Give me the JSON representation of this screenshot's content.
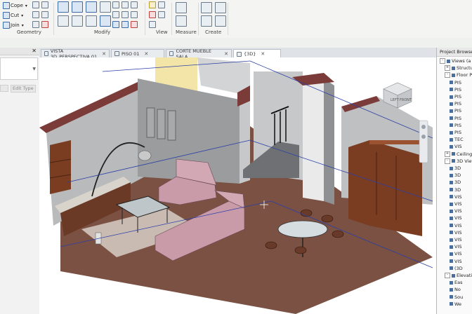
{
  "ribbon": {
    "cope_label": "Cope",
    "cut_label": "Cut",
    "join_label": "Join",
    "groups": {
      "geometry": "Geometry",
      "modify": "Modify",
      "view": "View",
      "measure": "Measure",
      "create": "Create"
    }
  },
  "properties": {
    "edit_type_label": "Edit Type"
  },
  "tabs": [
    {
      "label": "VISTA 3D_PERSPECTIVA 01",
      "active": false
    },
    {
      "label": "PISO 01",
      "active": false
    },
    {
      "label": "CORTE MUEBLE SALA",
      "active": false
    },
    {
      "label": "{3D}",
      "active": true
    }
  ],
  "viewcube": {
    "left": "LEFT",
    "front": "FRONT"
  },
  "project_browser": {
    "title": "Project Browser",
    "items": [
      {
        "label": "Views (a",
        "level": 0,
        "toggle": "-"
      },
      {
        "label": "Structu",
        "level": 1,
        "toggle": "+"
      },
      {
        "label": "Floor P",
        "level": 1,
        "toggle": "-"
      },
      {
        "label": "PIS",
        "level": 2
      },
      {
        "label": "PIS",
        "level": 2
      },
      {
        "label": "PIS",
        "level": 2
      },
      {
        "label": "PIS",
        "level": 2
      },
      {
        "label": "PIS",
        "level": 2
      },
      {
        "label": "PIS",
        "level": 2
      },
      {
        "label": "PIS",
        "level": 2
      },
      {
        "label": "PIS",
        "level": 2
      },
      {
        "label": "TEC",
        "level": 2
      },
      {
        "label": "VIS",
        "level": 2
      },
      {
        "label": "Ceiling",
        "level": 1,
        "toggle": "+"
      },
      {
        "label": "3D View",
        "level": 1,
        "toggle": "-"
      },
      {
        "label": "3D",
        "level": 2
      },
      {
        "label": "3D",
        "level": 2
      },
      {
        "label": "3D",
        "level": 2
      },
      {
        "label": "3D",
        "level": 2
      },
      {
        "label": "VIS",
        "level": 2
      },
      {
        "label": "VIS",
        "level": 2
      },
      {
        "label": "VIS",
        "level": 2
      },
      {
        "label": "VIS",
        "level": 2
      },
      {
        "label": "VIS",
        "level": 2
      },
      {
        "label": "VIS",
        "level": 2
      },
      {
        "label": "VIS",
        "level": 2
      },
      {
        "label": "VIS",
        "level": 2
      },
      {
        "label": "VIS",
        "level": 2
      },
      {
        "label": "VIS",
        "level": 2
      },
      {
        "label": "(3D",
        "level": 2
      },
      {
        "label": "Elevatio",
        "level": 1,
        "toggle": "-"
      },
      {
        "label": "Eas",
        "level": 2
      },
      {
        "label": "No",
        "level": 2
      },
      {
        "label": "Sou",
        "level": 2
      },
      {
        "label": "We",
        "level": 2
      }
    ]
  },
  "colors": {
    "floor": "#7a5142",
    "wall_exterior": "#7b3b38",
    "wall_inner": "#9a9c9e",
    "wall_light": "#c7c8c9",
    "accent_wall": "#f3e5a8",
    "sofa": "#c99aa8",
    "cabinet": "#7a3d22",
    "section_line": "#2b3fa8"
  }
}
